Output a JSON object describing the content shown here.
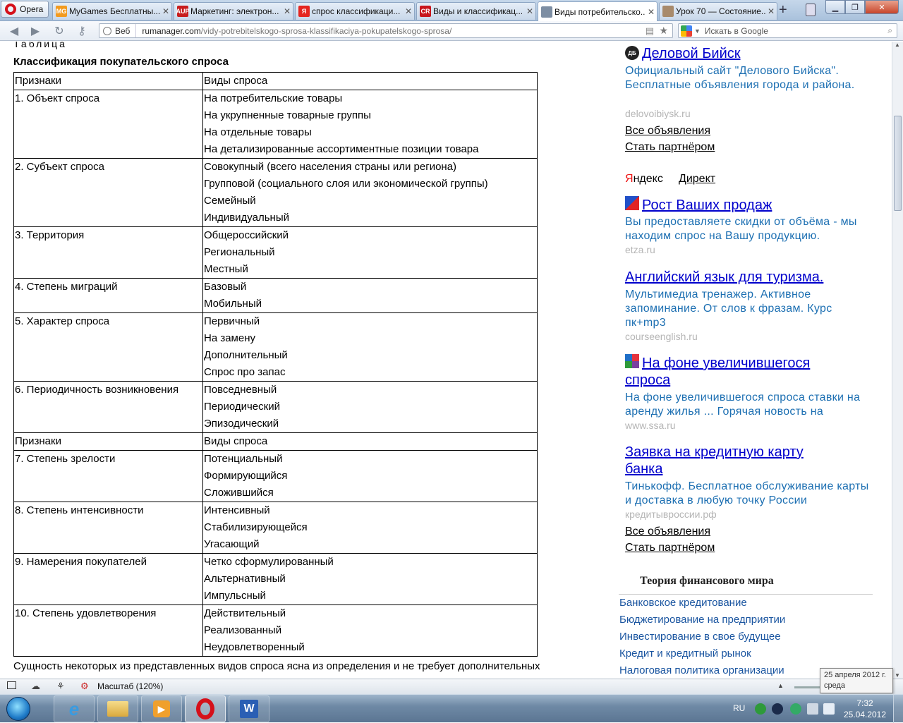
{
  "browser": {
    "menu_label": "Opera",
    "tabs": [
      {
        "title": "MyGames Бесплатны...",
        "fav": "MG",
        "fav_color": "#f29a1f"
      },
      {
        "title": "Маркетинг: электрон...",
        "fav": "AUP",
        "fav_color": "#c81d1d"
      },
      {
        "title": "спрос классификаци...",
        "fav": "Я",
        "fav_color": "#e52620"
      },
      {
        "title": "Виды и классификац...",
        "fav": "CR",
        "fav_color": "#c8161d"
      },
      {
        "title": "Виды потребительско...",
        "fav": "",
        "fav_color": "#7d8ea3"
      },
      {
        "title": "Урок 70 — Состояние...",
        "fav": "",
        "fav_color": "#a88a6b"
      }
    ],
    "url_scope": "Веб",
    "url_host": "rumanager.com",
    "url_path": "/vidy-potrebitelskogo-sprosa-klassifikaciya-pokupatelskogo-sprosa/",
    "search_placeholder": "Искать в Google"
  },
  "article": {
    "caption_1": "Таблица",
    "caption_2": "Классификация покупательского спроса",
    "table_rows": [
      {
        "sign": "Признаки",
        "values": [
          "Виды спроса"
        ]
      },
      {
        "sign": "1. Объект спроса",
        "values": [
          "На потребительские товары",
          "На укрупненные товарные группы",
          "На отдельные товары",
          "На детализированные ассортиментные позиции товара"
        ]
      },
      {
        "sign": "2. Субъект спроса",
        "values": [
          "Совокупный  (всего населения страны или региона)",
          "Групповой (социального слоя или экономической группы)",
          "Семейный",
          "Индивидуальный"
        ]
      },
      {
        "sign": "3. Территория",
        "values": [
          "Общероссийский",
          "Региональный",
          "Местный"
        ]
      },
      {
        "sign": "4. Степень миграций",
        "values": [
          "Базовый",
          "Мобильный"
        ]
      },
      {
        "sign": "5. Характер спроса",
        "values": [
          "Первичный",
          "На замену",
          "Дополнительный",
          "Спрос про запас"
        ]
      },
      {
        "sign": "6. Периодичность возникновения",
        "values": [
          "Повседневный",
          "Периодический",
          "Эпизодический"
        ]
      },
      {
        "sign": "Признаки",
        "values": [
          "Виды спроса"
        ]
      },
      {
        "sign": "7. Степень зрелости",
        "values": [
          "Потенциальный",
          "Формирующийся",
          "Сложившийся"
        ]
      },
      {
        "sign": "8. Степень интенсивности",
        "values": [
          "Интенсивный",
          "Стабилизирующейся",
          "Угасающий"
        ]
      },
      {
        "sign": "9. Намерения покупателей",
        "values": [
          "Четко сформулированный",
          "Альтернативный",
          "Импульсный"
        ]
      },
      {
        "sign": "10. Степень удовлетворения",
        "values": [
          "Действительный",
          "Реализованный",
          "Неудовлетворенный"
        ]
      }
    ],
    "bottom_text": "Сущность некоторых из представленных видов спроса ясна из определения и не требует дополнительных"
  },
  "sidebar": {
    "ad1": {
      "title": "Деловой Бийск",
      "icon_text": "ДБ",
      "text": "Официальный сайт \"Делового Бийска\". Бесплатные объявления города и района.",
      "domain": "delovoibiysk.ru"
    },
    "all_ads": "Все объявления",
    "become_partner": "Стать партнёром",
    "yandex_ya": "Я",
    "yandex_rest": "ндекс",
    "direct": "Директ",
    "ad2": {
      "title": "Рост Ваших продаж",
      "text": "Вы предоставляете скидки от объёма - мы находим спрос на Вашу продукцию.",
      "domain": "etza.ru"
    },
    "ad3": {
      "title": "Английский язык для туризма.",
      "text": "Мультимедиа тренажер. Активное запоминание. От слов к фразам. Курс пк+mp3",
      "domain": "courseenglish.ru"
    },
    "ad4": {
      "title_line1": "На фоне увеличившегося",
      "title_line2": "спроса",
      "text": "На фоне увеличившегося спроса ставки на аренду жилья ... Горячая новость на",
      "domain": "www.ssa.ru"
    },
    "ad5": {
      "title_line1": "Заявка на кредитную карту",
      "title_line2": "банка",
      "text": "Тинькофф. Бесплатное обслуживание карты и доставка в любую точку России",
      "domain": "кредитывроссии.рф"
    },
    "all_ads_2": "Все объявления",
    "become_partner_2": "Стать партнёром",
    "theory_heading": "Теория финансового мира",
    "theory_items": [
      "Банковское кредитование",
      "Бюджетирование на предприятии",
      "Инвестирование в свое будущее",
      "Кредит и кредитный рынок",
      "Налоговая политика организации"
    ]
  },
  "status": {
    "zoom": "Масштаб (120%)",
    "tooltip_line1": "25 апреля 2012 г.",
    "tooltip_line2": "среда"
  },
  "taskbar": {
    "lang": "RU",
    "time": "7:32",
    "date": "25.04.2012"
  }
}
